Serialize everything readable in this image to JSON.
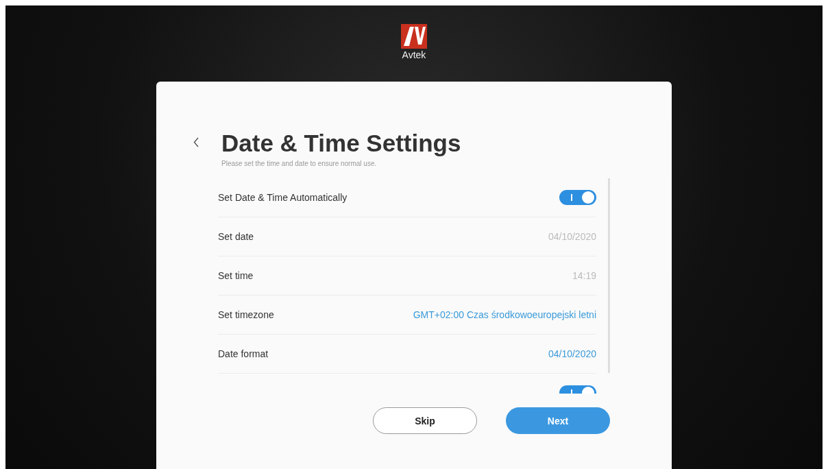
{
  "logo": {
    "text": "Avtek"
  },
  "title": "Date & Time Settings",
  "subtitle": "Please set the time and date to ensure normal use.",
  "rows": [
    {
      "kind": "toggle",
      "label": "Set Date & Time Automatically",
      "on": true
    },
    {
      "kind": "value",
      "label": "Set date",
      "value": "04/10/2020",
      "disabled": true
    },
    {
      "kind": "value",
      "label": "Set time",
      "value": "14:19",
      "disabled": true
    },
    {
      "kind": "value",
      "label": "Set timezone",
      "value": "GMT+02:00 Czas środkowoeuropejski letni",
      "disabled": false
    },
    {
      "kind": "value",
      "label": "Date format",
      "value": "04/10/2020",
      "disabled": false
    },
    {
      "kind": "toggle",
      "on": true
    }
  ],
  "buttons": [
    {
      "label": "Skip",
      "kind": "secondary"
    },
    {
      "label": "Next",
      "kind": "primary"
    }
  ]
}
